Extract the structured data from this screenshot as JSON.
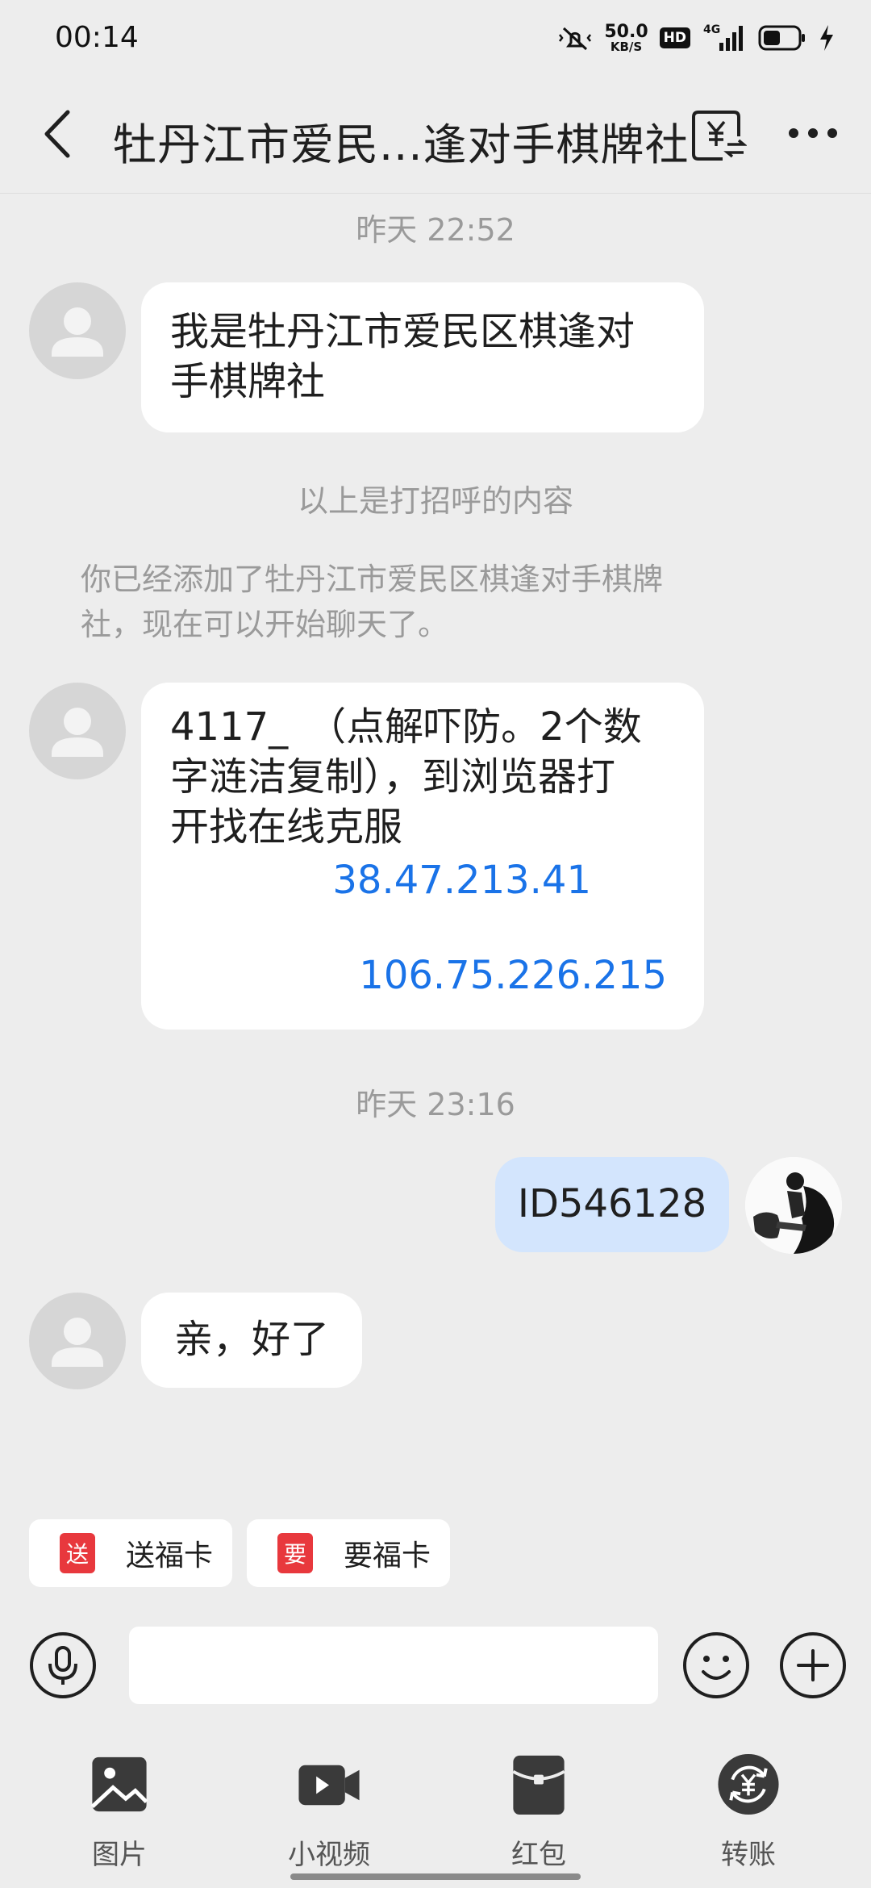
{
  "status_bar": {
    "time": "00:14",
    "net_speed_value": "50.0",
    "net_speed_unit": "KB/S",
    "hd": "HD",
    "signal": "4G",
    "icons": [
      "mute-icon",
      "hd-icon",
      "signal-icon",
      "battery-icon",
      "charging-icon"
    ]
  },
  "header": {
    "title": "牡丹江市爱民...逢对手棋牌社",
    "back_icon": "chevron-left-icon",
    "transfer_icon": "yuan-transfer-icon",
    "more_icon": "more-icon"
  },
  "messages": {
    "ts1": "昨天 22:52",
    "m1_line1": "我是牡丹江市爱民区棋逢对",
    "m1_line2": "手棋牌社",
    "sys1": "以上是打招呼的内容",
    "sys2_line1": "你已经添加了牡丹江市爱民区棋逢对手棋牌",
    "sys2_line2": "社，现在可以开始聊天了。",
    "m2_line1": "4117_　（点解吓防。2个数",
    "m2_line2": "字涟洁复制），到浏览器打",
    "m2_line3": "开找在线克服",
    "m2_link1": "38.47.213.41",
    "m2_link2": "106.75.226.215",
    "ts2": "昨天 23:16",
    "m3": "ID546128",
    "m4": "亲，好了"
  },
  "quick_actions": [
    {
      "icon_text": "送",
      "label": "送福卡"
    },
    {
      "icon_text": "要",
      "label": "要福卡"
    }
  ],
  "input": {
    "placeholder": "",
    "value": ""
  },
  "toolbar": [
    {
      "label": "图片",
      "icon": "image-icon"
    },
    {
      "label": "小视频",
      "icon": "video-icon"
    },
    {
      "label": "红包",
      "icon": "red-packet-icon"
    },
    {
      "label": "转账",
      "icon": "transfer-icon"
    }
  ],
  "colors": {
    "background": "#ededed",
    "bubble_in": "#ffffff",
    "bubble_out": "#d3e5fd",
    "link": "#1a73e8",
    "chip_icon": "#e8383d"
  }
}
